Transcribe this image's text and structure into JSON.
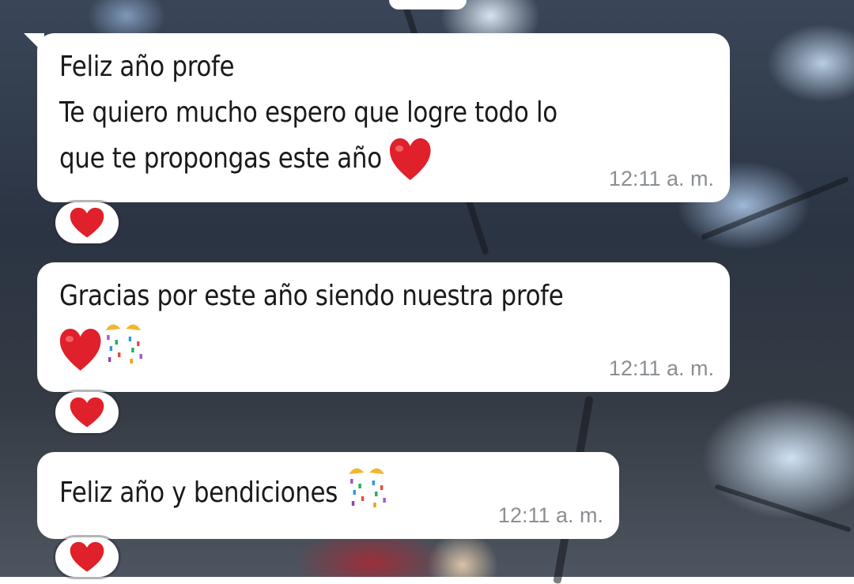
{
  "messages": [
    {
      "lines": [
        "Feliz año profe",
        "Te quiero mucho espero que logre todo lo",
        "que te propongas este año"
      ],
      "trailing_emoji": "heart-emoji",
      "time": "12:11 a. m.",
      "reaction": "heart-emoji"
    },
    {
      "lines": [
        "Gracias por este año siendo nuestra profe"
      ],
      "trailing_emoji": "heart-and-party-popper-emoji",
      "time": "12:11 a. m.",
      "reaction": "heart-emoji"
    },
    {
      "lines": [
        "Feliz año y bendiciones"
      ],
      "trailing_emoji": "party-popper-emoji",
      "time": "12:11 a. m.",
      "reaction": "heart-emoji"
    }
  ],
  "colors": {
    "bubble": "#ffffff",
    "text": "#1a1a1a",
    "timestamp": "#8a8f94",
    "heart": "#e0202a"
  }
}
